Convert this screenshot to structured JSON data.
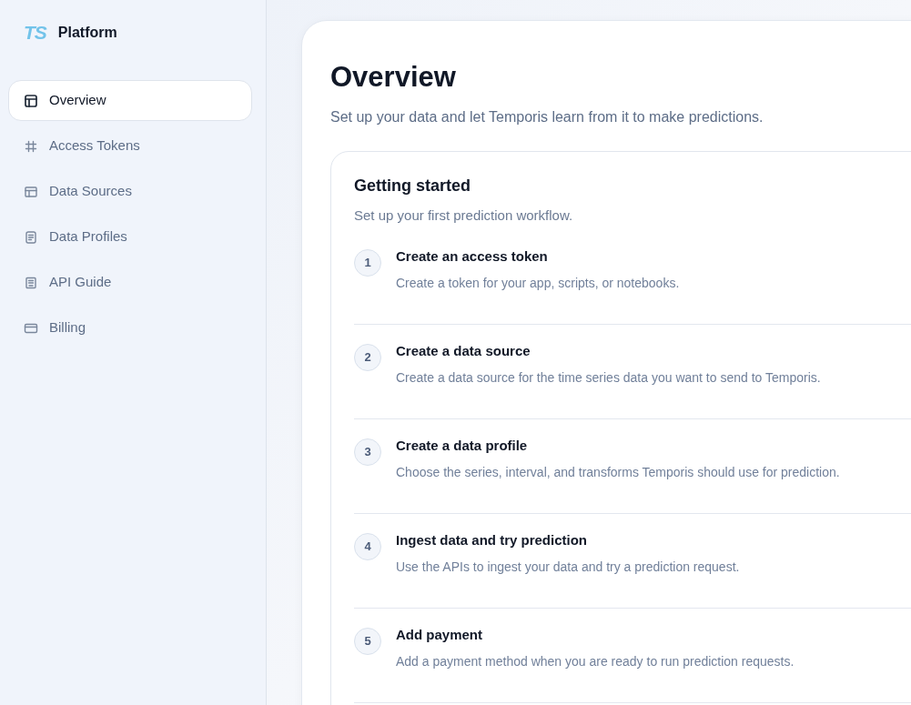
{
  "sidebar": {
    "brand": {
      "logo": "TS",
      "name": "Platform"
    },
    "items": [
      {
        "label": "Overview",
        "selected": true
      },
      {
        "label": "Access Tokens",
        "selected": false
      },
      {
        "label": "Data Sources",
        "selected": false
      },
      {
        "label": "Data Profiles",
        "selected": false
      },
      {
        "label": "API Guide",
        "selected": false
      },
      {
        "label": "Billing",
        "selected": false
      }
    ]
  },
  "page": {
    "title": "Overview",
    "subtitle": "Set up your data and let Temporis learn from it to make predictions."
  },
  "getting_started": {
    "title": "Getting started",
    "subtitle": "Set up your first prediction workflow.",
    "steps": [
      {
        "number": "1",
        "title": "Create an access token",
        "description": "Create a token for your app, scripts, or notebooks."
      },
      {
        "number": "2",
        "title": "Create a data source",
        "description": "Create a data source for the time series data you want to send to Temporis."
      },
      {
        "number": "3",
        "title": "Create a data profile",
        "description": "Choose the series, interval, and transforms Temporis should use for prediction."
      },
      {
        "number": "4",
        "title": "Ingest data and try prediction",
        "description": "Use the APIs to ingest your data and try a prediction request."
      },
      {
        "number": "5",
        "title": "Add payment",
        "description": "Add a payment method when you are ready to run prediction requests."
      }
    ]
  }
}
